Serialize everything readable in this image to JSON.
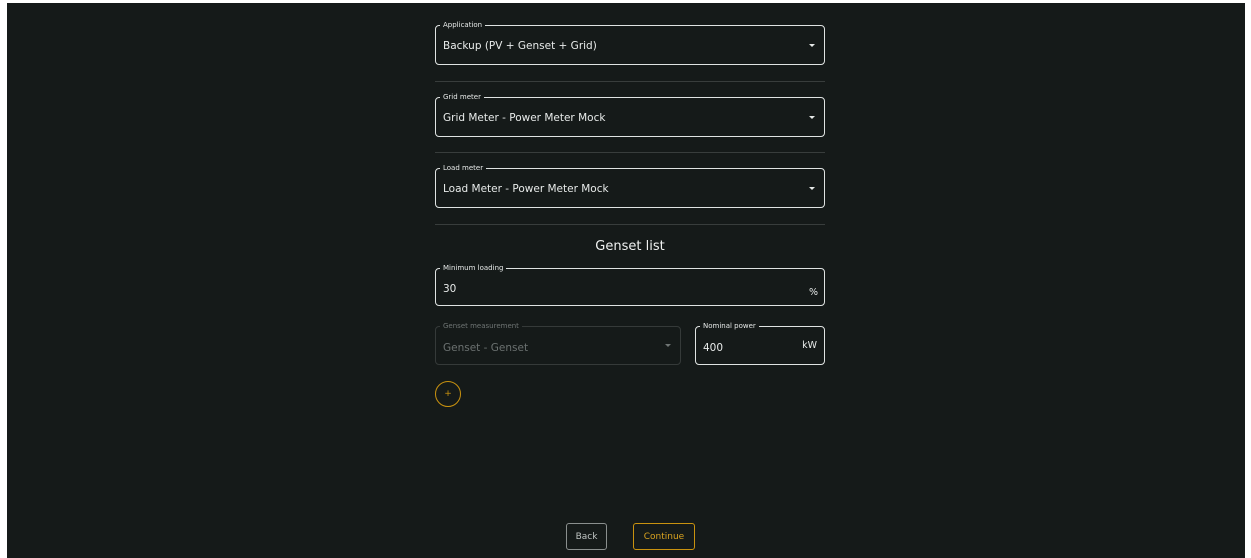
{
  "application": {
    "label": "Application",
    "value": "Backup (PV + Genset + Grid)"
  },
  "grid_meter": {
    "label": "Grid meter",
    "value": "Grid Meter - Power Meter Mock"
  },
  "load_meter": {
    "label": "Load meter",
    "value": "Load Meter - Power Meter Mock"
  },
  "genset_list": {
    "title": "Genset list",
    "minimum_loading": {
      "label": "Minimum loading",
      "value": "30",
      "unit": "%"
    },
    "genset_measurement": {
      "label": "Genset measurement",
      "value": "Genset - Genset",
      "disabled": true
    },
    "nominal_power": {
      "label": "Nominal power",
      "value": "400",
      "unit": "kW"
    },
    "add_icon": "plus-icon",
    "add_symbol": "+"
  },
  "footer": {
    "back_label": "Back",
    "continue_label": "Continue"
  },
  "colors": {
    "background": "#151a19",
    "accent": "#c9920f",
    "border": "#dfe3e2",
    "divider": "#383d3c"
  }
}
